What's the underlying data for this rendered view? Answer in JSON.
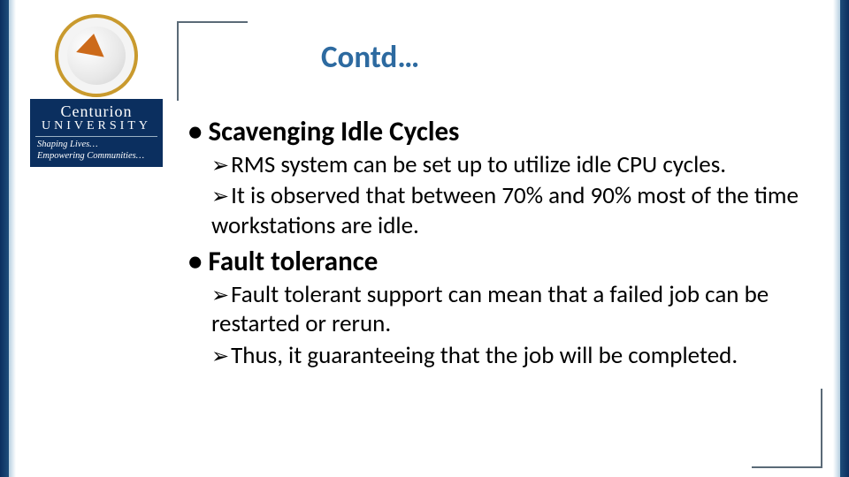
{
  "logo": {
    "name_line1": "Centurion",
    "name_line2": "UNIVERSITY",
    "tagline_line1": "Shaping Lives…",
    "tagline_line2": "Empowering Communities…"
  },
  "title": "Contd…",
  "bullets": [
    {
      "heading": "Scavenging Idle Cycles",
      "points": [
        "RMS system can be set up to utilize idle CPU cycles.",
        "It is observed that between 70% and 90% most of the time workstations are idle."
      ]
    },
    {
      "heading": "Fault tolerance",
      "points": [
        "Fault tolerant support can mean that a failed job can be restarted or rerun.",
        "Thus, it guaranteeing that the job will be completed."
      ]
    }
  ]
}
